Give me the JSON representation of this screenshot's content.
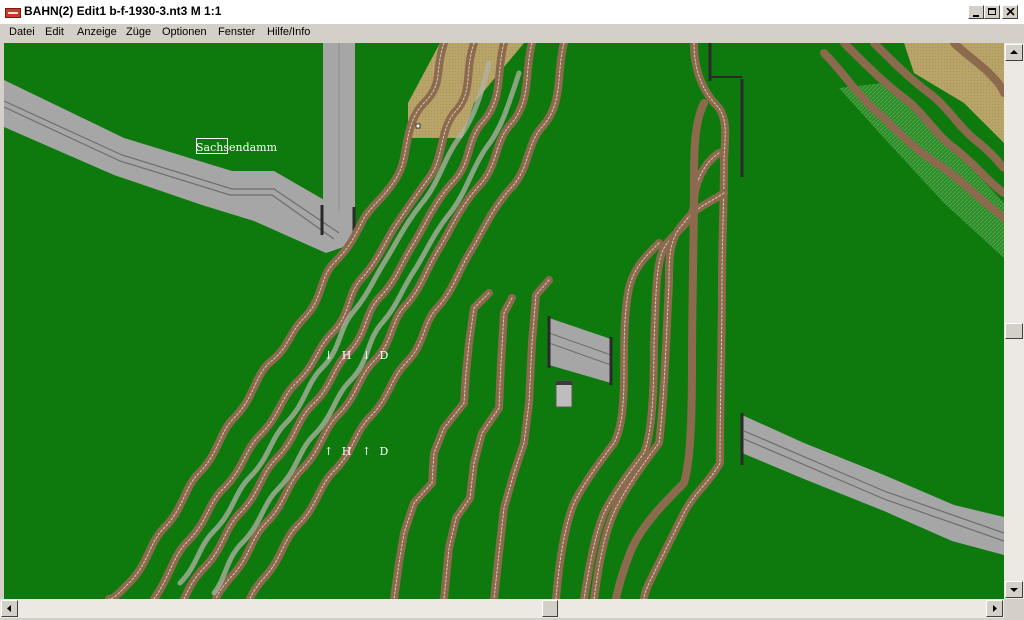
{
  "window": {
    "title": "BAHN(2) Edit1 b-f-1930-3.nt3 M 1:1",
    "controls": [
      "minimize",
      "maximize",
      "close"
    ]
  },
  "menu": {
    "items": [
      "Datei",
      "Edit",
      "Anzeige",
      "Züge",
      "Optionen",
      "Fenster",
      "Hilfe/Info"
    ]
  },
  "map": {
    "station_label": "Sachsendamm",
    "signal_group_top": [
      "↓",
      "H",
      "↓",
      "D"
    ],
    "signal_group_bottom": [
      "↑",
      "H",
      "↑",
      "D"
    ],
    "colors": {
      "grass": "#0e7a0e",
      "road": "#a6a6a6",
      "sand": "#b8a468",
      "rail_bed": "#8b6a4e",
      "ballast": "#b3b3a8"
    }
  },
  "scrollbars": {
    "vertical_position": 0.52,
    "horizontal_position": 0.55
  }
}
